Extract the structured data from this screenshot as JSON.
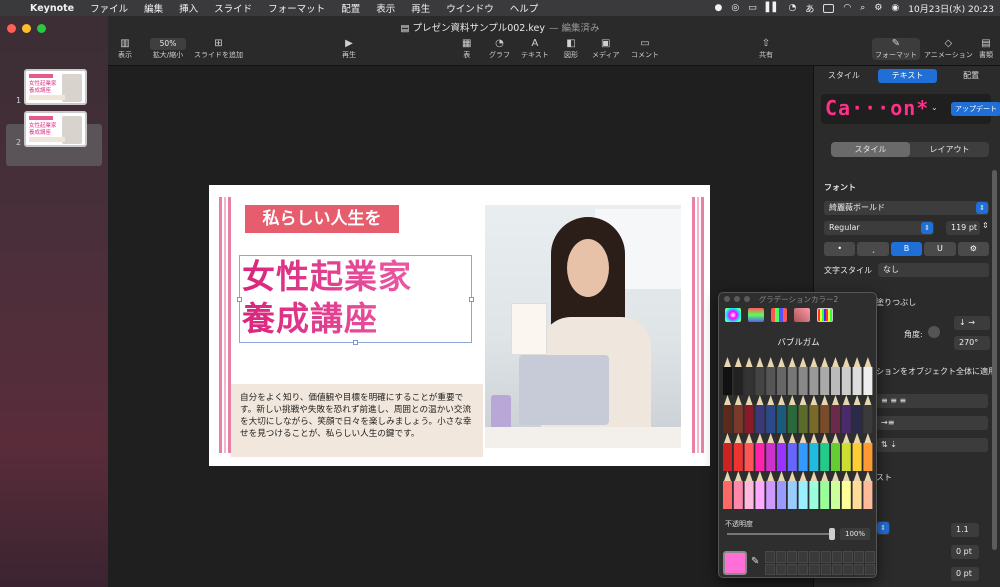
{
  "menubar": {
    "app": "Keynote",
    "items": [
      "ファイル",
      "編集",
      "挿入",
      "スライド",
      "フォーマット",
      "配置",
      "表示",
      "再生",
      "ウインドウ",
      "ヘルプ"
    ],
    "ime": "あ",
    "clock": "10月23日(水) 20:23"
  },
  "document": {
    "title": "プレゼン資料サンプル002.key",
    "status": "— 編集済み"
  },
  "toolbar": {
    "view": "表示",
    "zoom_value": "50%",
    "zoom_label": "拡大/縮小",
    "add_slide": "スライドを追加",
    "play": "再生",
    "table": "表",
    "chart": "グラフ",
    "text": "テキスト",
    "shape": "図形",
    "media": "メディア",
    "comment": "コメント",
    "share": "共有",
    "format": "フォーマット",
    "animate": "アニメーション",
    "document": "書類"
  },
  "slides": {
    "thumb1_number": "1",
    "thumb2_number": "2",
    "thumb_title": "女性起業家\n養成講座"
  },
  "slide": {
    "badge": "私らしい人生を",
    "title_line1": "女性起業家",
    "title_line2": "養成講座",
    "body": "自分をよく知り、価値観や目標を明確にすることが重要です。新しい挑戦や失敗を恐れず前進し、周囲との温かい交流を大切にしながら、笑顔で日々を楽しみましょう。小さな幸せを見つけることが、私らしい人生の鍵です。"
  },
  "inspector": {
    "tab_style": "スタイル",
    "tab_text": "テキスト",
    "tab_arrange": "配置",
    "style_sample": "Ca···on*",
    "update_button": "アップデート",
    "seg_style": "スタイル",
    "seg_layout": "レイアウト",
    "font_header": "フォント",
    "font_family": "綺麗薇ボールド",
    "font_weight": "Regular",
    "font_size": "119 pt",
    "bold": "B",
    "underline": "U",
    "char_style_label": "文字スタイル",
    "char_style_value": "なし",
    "fill_label": "塗りつぶし",
    "angle_label": "角度:",
    "angle_value": "270°",
    "apply_label": "ションをオブジェクト全体に適用",
    "text_frag": "スト",
    "spacing_value": "1.1",
    "before_value": "0 pt",
    "after_value": "0 pt"
  },
  "palette": {
    "window_title": "グラデーションカラー2",
    "name": "バブルガム",
    "opacity_label": "不透明度",
    "opacity_value": "100%",
    "selected_color": "#ff6fd6"
  }
}
